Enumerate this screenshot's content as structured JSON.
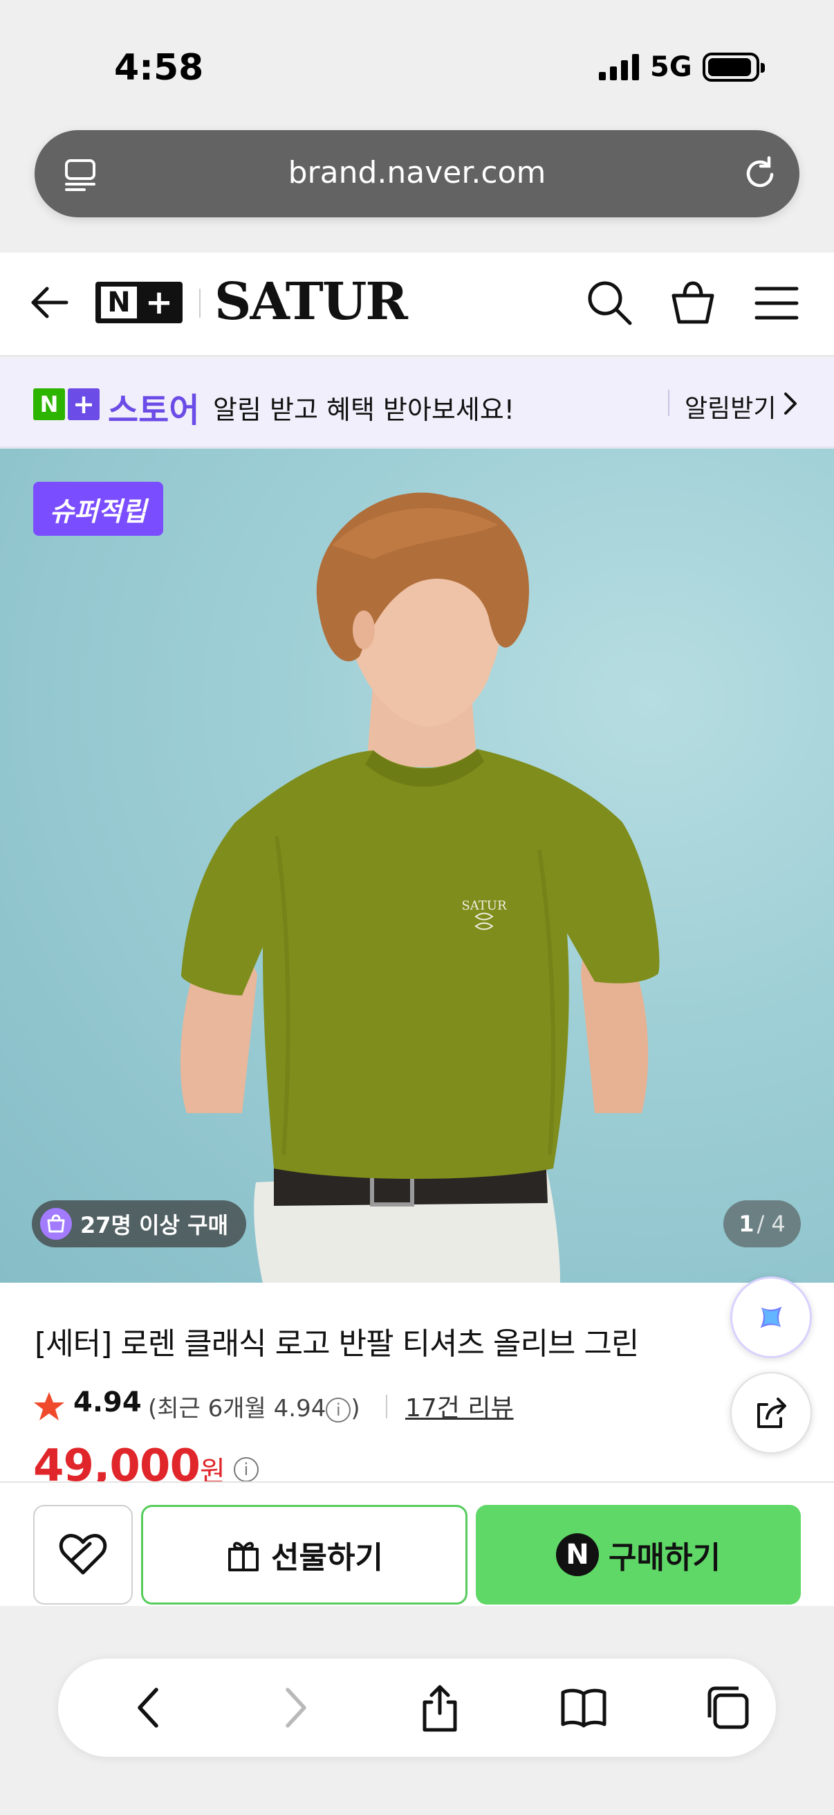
{
  "status": {
    "time": "4:58",
    "network": "5G"
  },
  "browser": {
    "url": "brand.naver.com"
  },
  "header": {
    "logo_n": "N",
    "logo_plus": "+",
    "brand": "SATUR"
  },
  "promo": {
    "badge_n": "N",
    "badge_plus": "+",
    "store_label": "스토어",
    "message": "알림 받고 혜택 받아보세요!",
    "cta": "알림받기"
  },
  "hero": {
    "tag": "슈퍼적립",
    "buyers": "27명 이상 구매",
    "page_current": "1",
    "page_total": "/ 4",
    "shirt_logo": "SATUR"
  },
  "product": {
    "title": "[세터] 로렌 클래식 로고 반팔 티셔츠 올리브 그린",
    "rating": "4.94",
    "recent_prefix": "(최근 6개월 4.94",
    "recent_suffix": ")",
    "info_glyph": "i",
    "reviews": "17건 리뷰",
    "price": "49,000",
    "price_unit": "원"
  },
  "actions": {
    "gift_label": "선물하기",
    "buy_label": "구매하기",
    "npay_glyph": "N"
  },
  "colors": {
    "naver_green": "#5fd867",
    "price_red": "#e0262a",
    "store_purple": "#6b4ce6",
    "tag_purple": "#7a4dff"
  }
}
